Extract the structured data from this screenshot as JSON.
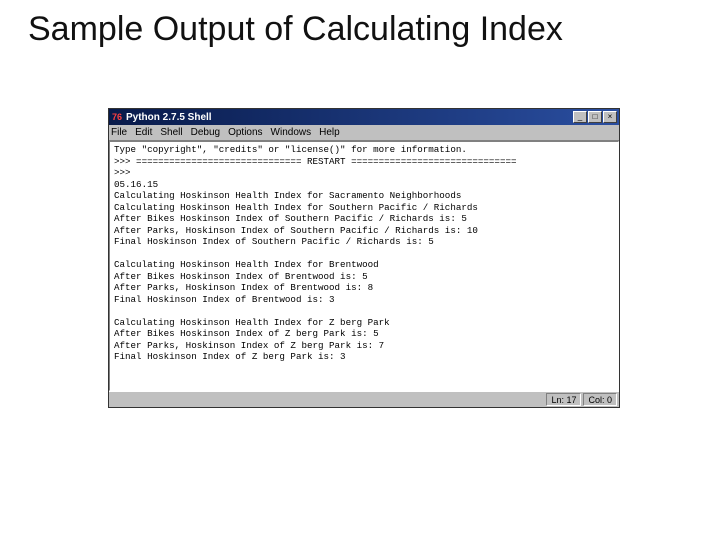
{
  "slide": {
    "title": "Sample Output of Calculating Index"
  },
  "window": {
    "sysicon": "76",
    "title": "Python 2.7.5 Shell",
    "buttons": {
      "min": "_",
      "max": "□",
      "close": "×"
    },
    "menu": {
      "file": "File",
      "edit": "Edit",
      "shell": "Shell",
      "debug": "Debug",
      "options": "Options",
      "windows": "Windows",
      "help": "Help"
    },
    "status": {
      "ln": "Ln: 17",
      "col": "Col: 0"
    }
  },
  "terminal": {
    "lines": [
      "Type \"copyright\", \"credits\" or \"license()\" for more information.",
      ">>> ============================== RESTART ==============================",
      ">>> ",
      "05.16.15",
      "Calculating Hoskinson Health Index for Sacramento Neighborhoods",
      "Calculating Hoskinson Health Index for Southern Pacific / Richards",
      "After Bikes Hoskinson Index of Southern Pacific / Richards is: 5",
      "After Parks, Hoskinson Index of Southern Pacific / Richards is: 10",
      "Final Hoskinson Index of Southern Pacific / Richards is: 5",
      "",
      "Calculating Hoskinson Health Index for Brentwood",
      "After Bikes Hoskinson Index of Brentwood is: 5",
      "After Parks, Hoskinson Index of Brentwood is: 8",
      "Final Hoskinson Index of Brentwood is: 3",
      "",
      "Calculating Hoskinson Health Index for Z berg Park",
      "After Bikes Hoskinson Index of Z berg Park is: 5",
      "After Parks, Hoskinson Index of Z berg Park is: 7",
      "Final Hoskinson Index of Z berg Park is: 3",
      ""
    ]
  }
}
